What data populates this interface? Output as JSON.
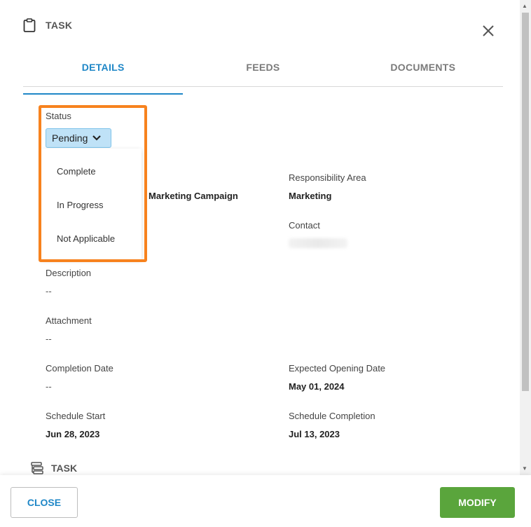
{
  "header": {
    "title": "TASK",
    "icon": "clipboard-icon"
  },
  "tabs": [
    {
      "label": "DETAILS",
      "active": true
    },
    {
      "label": "FEEDS",
      "active": false
    },
    {
      "label": "DOCUMENTS",
      "active": false
    }
  ],
  "status": {
    "label": "Status",
    "value": "Pending",
    "options": [
      "Complete",
      "In Progress",
      "Not Applicable"
    ]
  },
  "fields": {
    "task_name_value": "Marketing Campaign",
    "responsibility_area": {
      "label": "Responsibility Area",
      "value": "Marketing"
    },
    "contact": {
      "label": "Contact"
    },
    "description": {
      "label": "Description",
      "value": "--"
    },
    "attachment": {
      "label": "Attachment",
      "value": "--"
    },
    "completion_date": {
      "label": "Completion Date",
      "value": "--"
    },
    "expected_opening_date": {
      "label": "Expected Opening Date",
      "value": "May 01, 2024"
    },
    "schedule_start": {
      "label": "Schedule Start",
      "value": "Jun 28, 2023"
    },
    "schedule_completion": {
      "label": "Schedule Completion",
      "value": "Jul 13, 2023"
    }
  },
  "task_section": {
    "title": "TASK"
  },
  "footer": {
    "close_label": "CLOSE",
    "modify_label": "MODIFY"
  },
  "colors": {
    "accent": "#1f87c7",
    "highlight": "#f7821e",
    "modify": "#5aa53c",
    "status_bg": "#bfe2f7"
  }
}
